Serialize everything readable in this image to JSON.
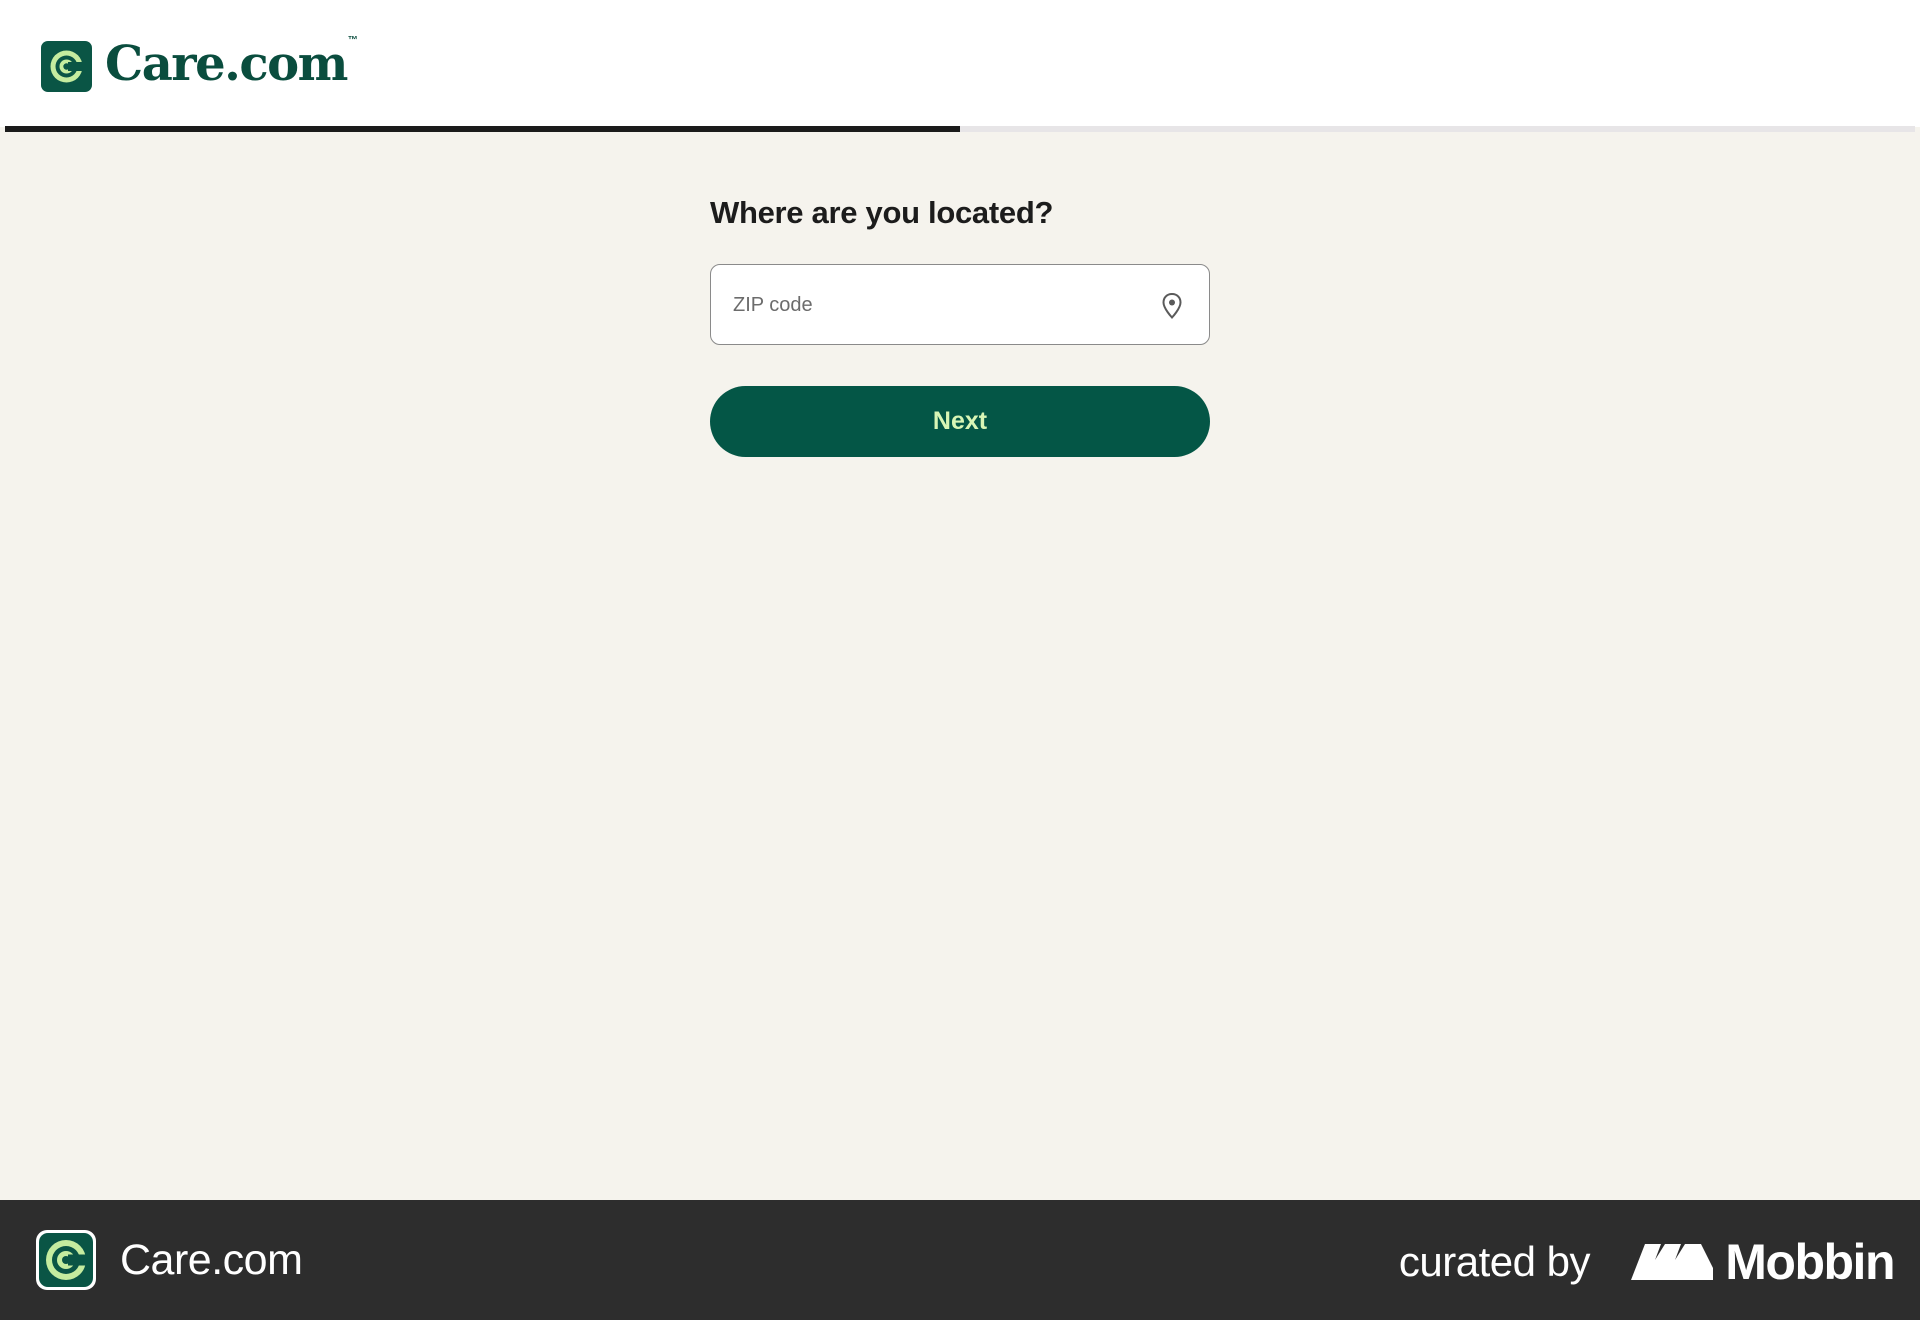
{
  "header": {
    "brand_name": "Care.com",
    "brand_tm": "TM",
    "logo_icon": "care-c-logo-icon",
    "progress_value": 0.5
  },
  "form": {
    "question": "Where are you located?",
    "zip": {
      "placeholder": "ZIP code",
      "value": "",
      "icon": "location-pin-icon"
    },
    "next_label": "Next"
  },
  "footer": {
    "app_name": "Care.com",
    "curated_by": "curated by",
    "mobbin_label": "Mobbin"
  },
  "colors": {
    "brand_green": "#045646",
    "brand_lime": "#d8f5b5",
    "page_bg": "#f5f3ed",
    "progress_fill": "#1b1b1b",
    "footer_bg": "#2d2d2d"
  }
}
